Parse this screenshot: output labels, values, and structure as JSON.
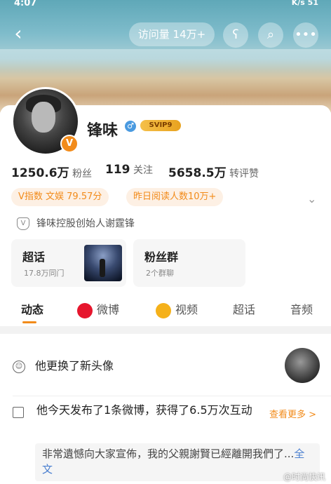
{
  "status_bar": {
    "time": "4:07",
    "right": "K/s  51"
  },
  "header": {
    "visits": "访问量 14万+"
  },
  "profile": {
    "name": "锋味",
    "gender_symbol": "♂",
    "svip": "SVIP9",
    "v_badge": "V",
    "stats": [
      {
        "value": "1250.6万",
        "label": "粉丝"
      },
      {
        "value": "119",
        "label": "关注"
      },
      {
        "value": "5658.5万",
        "label": "转评赞"
      }
    ],
    "tags": [
      "V指数 文娱 79.57分",
      "昨日阅读人数10万+"
    ],
    "certification": "锋味控股创始人谢霆锋"
  },
  "boxes": [
    {
      "title": "超话",
      "sub": "17.8万同门"
    },
    {
      "title": "粉丝群",
      "sub": "2个群聊"
    }
  ],
  "tabs": [
    "动态",
    "微博",
    "视频",
    "超话",
    "音频"
  ],
  "feed": {
    "item1": "他更换了新头像",
    "item2": "他今天发布了1条微博，获得了6.5万次互动",
    "more": "查看更多 >",
    "quote": "非常遺憾向大家宣佈，我的父親謝賢已經離開我們了...",
    "quote_link": "全文"
  },
  "watermark": "@时尚快讯",
  "colors": {
    "accent": "#f28b1a",
    "link": "#4a7fd0"
  },
  "icons": [
    "back-icon",
    "bear-icon",
    "search-icon",
    "more-icon",
    "shield-icon",
    "smile-icon",
    "chart-icon",
    "weibo-icon",
    "video-icon"
  ]
}
